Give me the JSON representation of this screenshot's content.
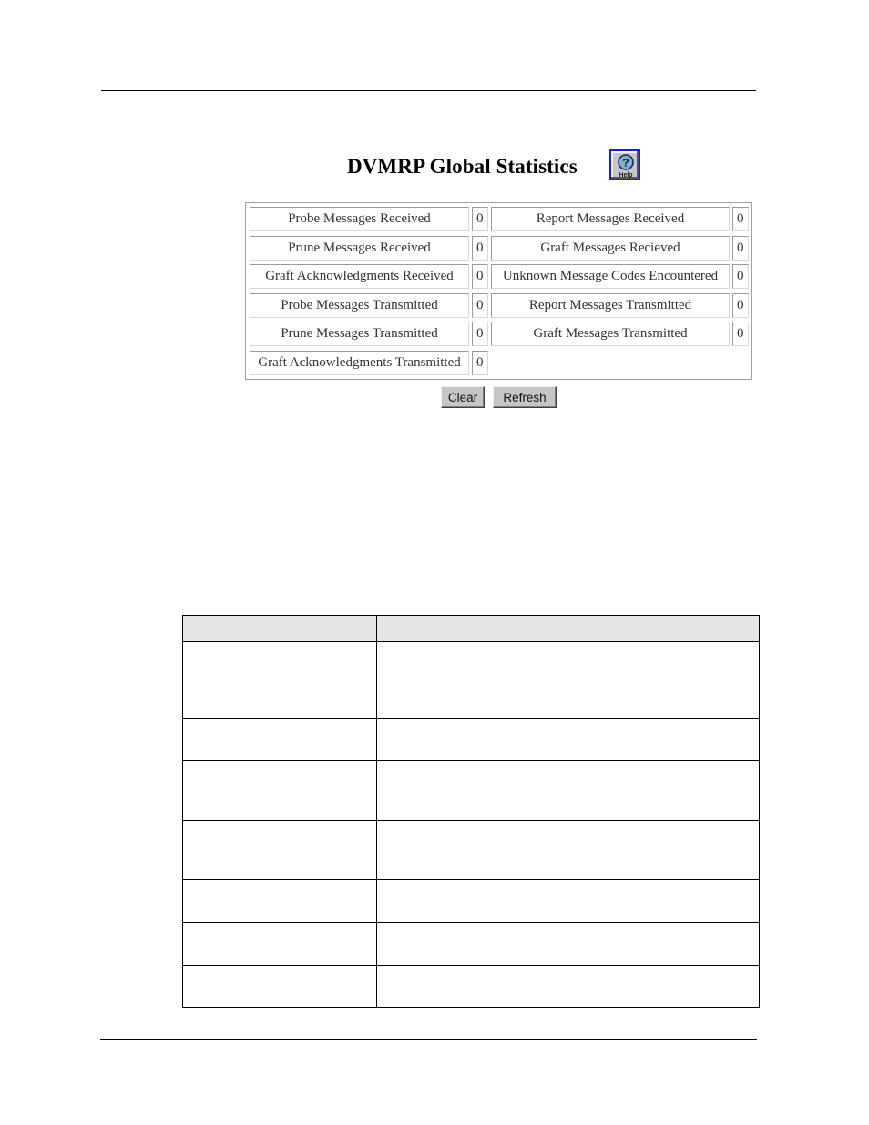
{
  "page": {
    "title": "DVMRP Global Statistics",
    "help_button": {
      "label": "Help",
      "icon": "help-question-icon"
    }
  },
  "stats": {
    "rows": [
      {
        "left": {
          "label": "Probe Messages Received",
          "value": "0"
        },
        "right": {
          "label": "Report Messages Received",
          "value": "0"
        }
      },
      {
        "left": {
          "label": "Prune Messages Received",
          "value": "0"
        },
        "right": {
          "label": "Graft Messages Recieved",
          "value": "0"
        }
      },
      {
        "left": {
          "label": "Graft Acknowledgments Received",
          "value": "0"
        },
        "right": {
          "label": "Unknown Message Codes Encountered",
          "value": "0"
        }
      },
      {
        "left": {
          "label": "Probe Messages Transmitted",
          "value": "0"
        },
        "right": {
          "label": "Report Messages Transmitted",
          "value": "0"
        }
      },
      {
        "left": {
          "label": "Prune Messages Transmitted",
          "value": "0"
        },
        "right": {
          "label": "Graft Messages Transmitted",
          "value": "0"
        }
      },
      {
        "left": {
          "label": "Graft Acknowledgments Transmitted",
          "value": "0"
        }
      }
    ]
  },
  "buttons": {
    "clear": "Clear",
    "refresh": "Refresh"
  },
  "description_table": {
    "header": [
      "",
      ""
    ],
    "rows": [
      [
        "",
        ""
      ],
      [
        "",
        ""
      ],
      [
        "",
        ""
      ],
      [
        "",
        ""
      ],
      [
        "",
        ""
      ],
      [
        "",
        ""
      ],
      [
        "",
        ""
      ]
    ]
  }
}
